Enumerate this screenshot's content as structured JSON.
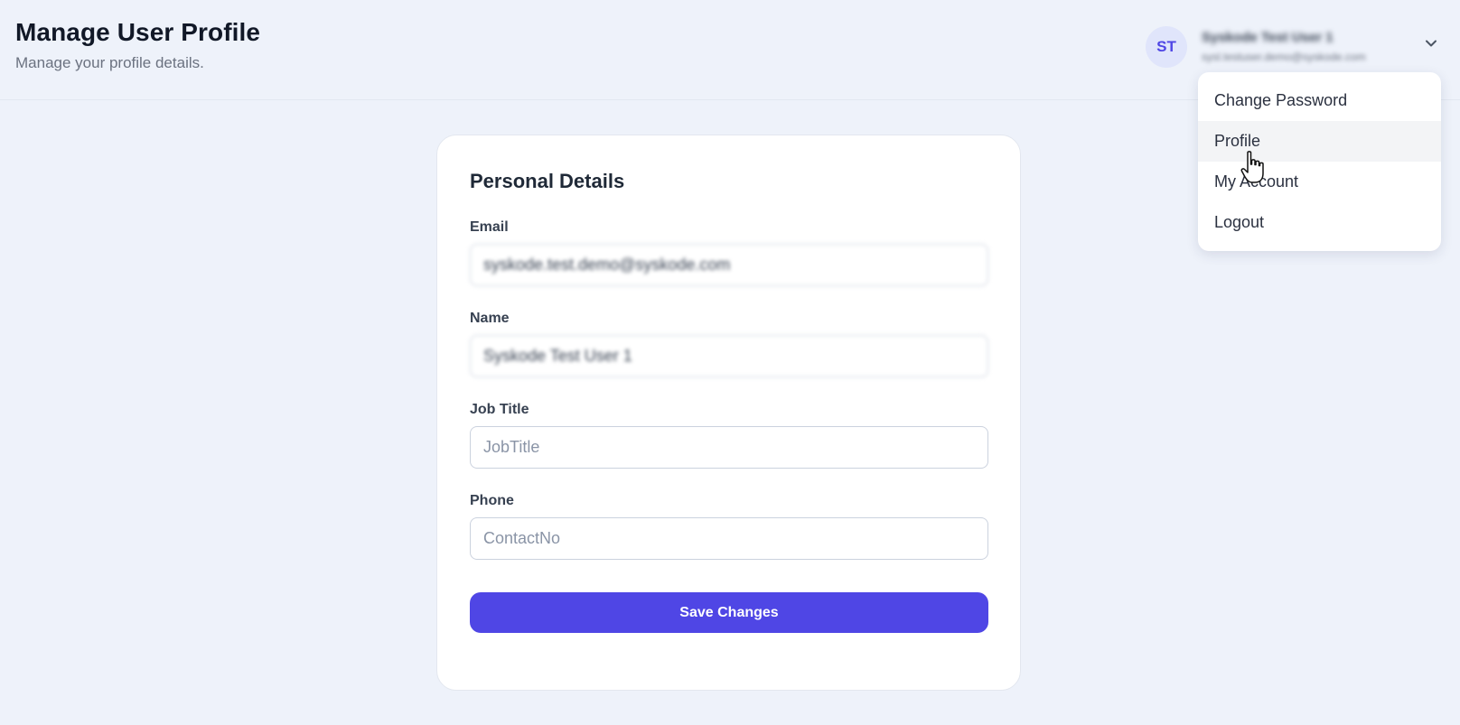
{
  "header": {
    "title": "Manage User Profile",
    "subtitle": "Manage your profile details."
  },
  "user": {
    "initials": "ST",
    "name": "Syskode Test User 1",
    "email": "sysl.testuser.demo@syskode.com"
  },
  "dropdown": {
    "items": [
      {
        "label": "Change Password"
      },
      {
        "label": "Profile"
      },
      {
        "label": "My Account"
      },
      {
        "label": "Logout"
      }
    ],
    "active_item": "Profile"
  },
  "form": {
    "title": "Personal Details",
    "email": {
      "label": "Email",
      "value": "syskode.test.demo@syskode.com"
    },
    "name": {
      "label": "Name",
      "value": "Syskode Test User 1"
    },
    "job_title": {
      "label": "Job Title",
      "placeholder": "JobTitle",
      "value": ""
    },
    "phone": {
      "label": "Phone",
      "placeholder": "ContactNo",
      "value": ""
    },
    "save_label": "Save Changes"
  },
  "colors": {
    "accent": "#4f46e5",
    "background": "#eef2fa",
    "avatar_bg": "#e0e5fb"
  },
  "icons": {
    "chevron": "chevron-down-icon",
    "cursor": "hand-pointer-cursor-icon"
  }
}
